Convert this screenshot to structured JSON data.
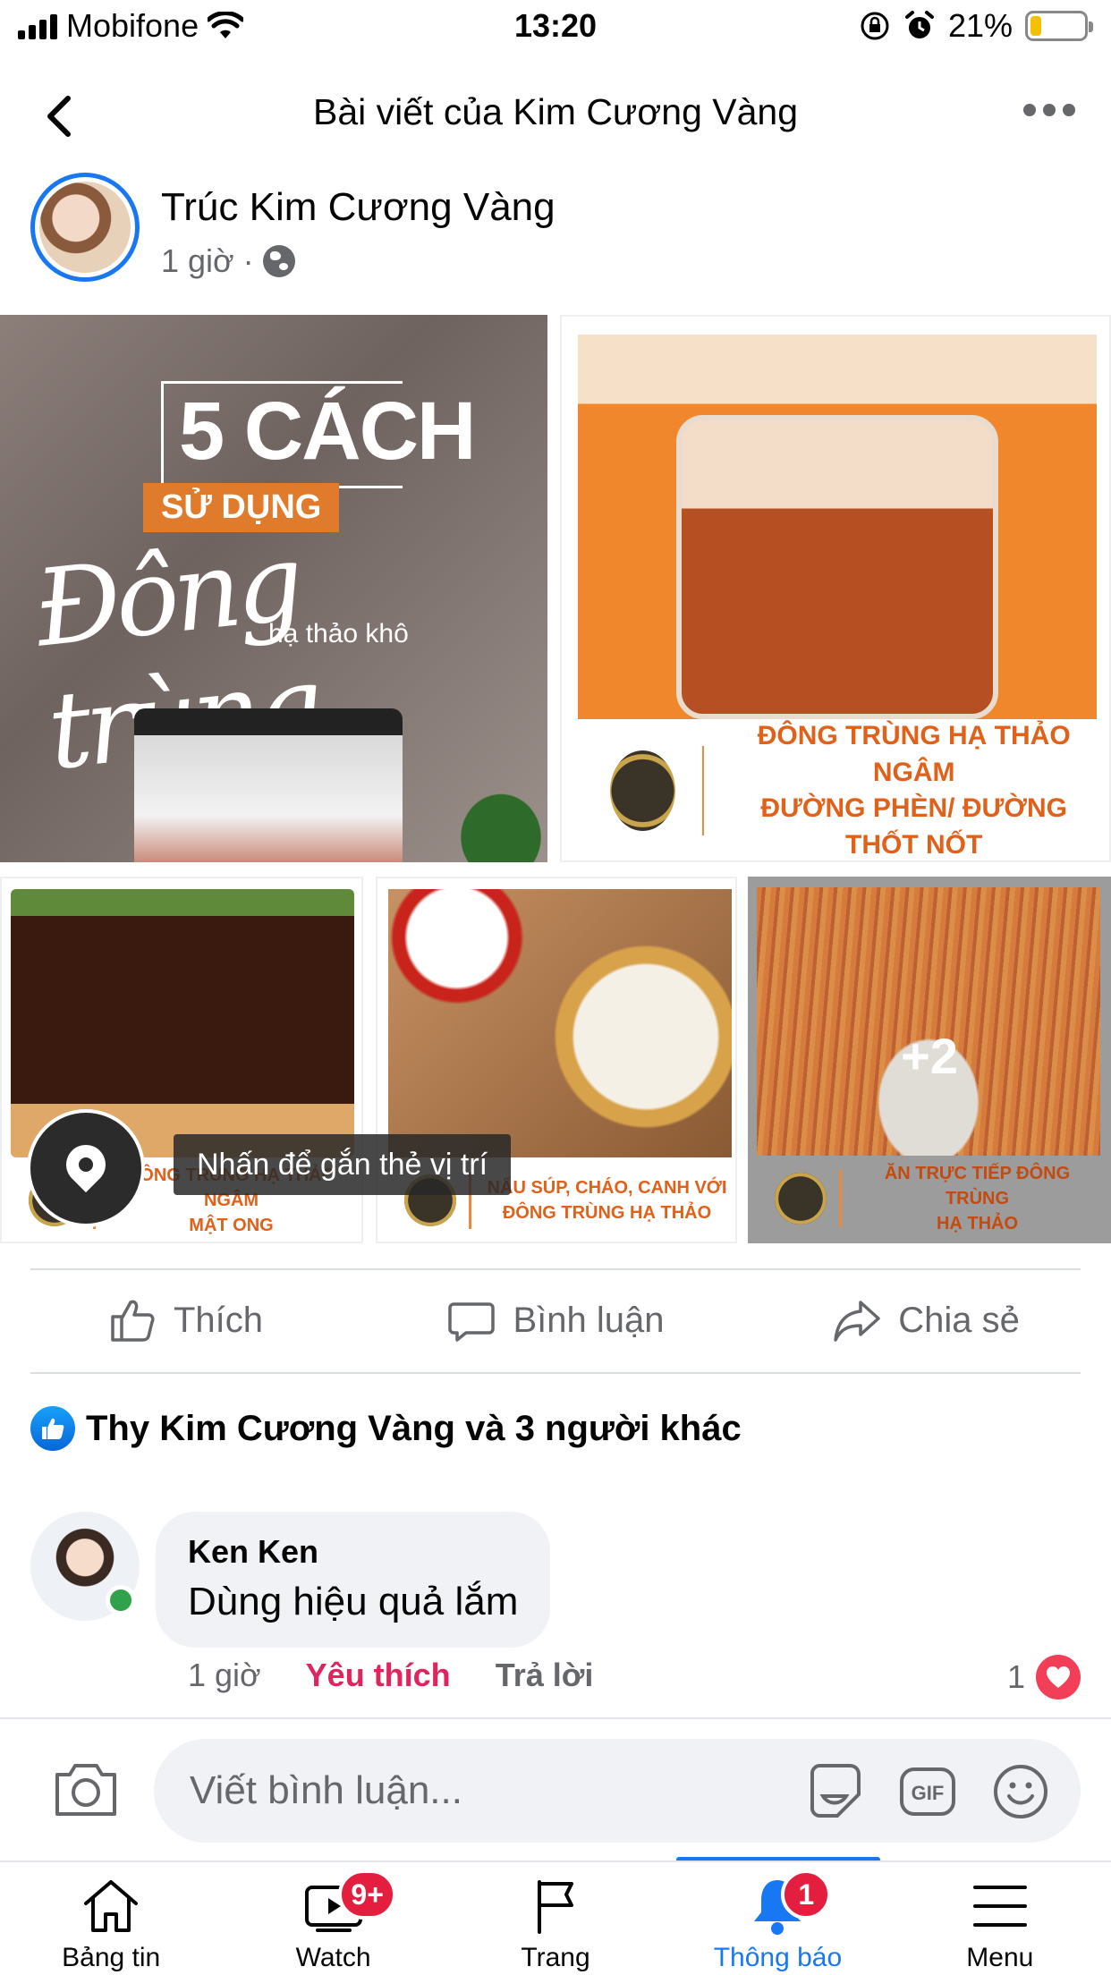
{
  "status_bar": {
    "carrier": "Mobifone",
    "time": "13:20",
    "battery_percent": "21%",
    "battery_level": 0.21
  },
  "header": {
    "title": "Bài viết của Kim Cương Vàng"
  },
  "post": {
    "author": "Trúc Kim Cương Vàng",
    "time": "1 giờ",
    "separator": "·",
    "privacy_icon": "globe-icon",
    "photos": {
      "photo1": {
        "big_text": "5 CÁCH",
        "tag_text": "SỬ DỤNG",
        "script_text": "Đông trùng",
        "sub_text": "hạ thảo khô"
      },
      "photo2": {
        "caption_line1": "ĐÔNG TRÙNG HẠ THẢO NGÂM",
        "caption_line2": "ĐƯỜNG PHÈN/ ĐƯỜNG THỐT NỐT"
      },
      "photo3": {
        "caption_line1": "ĐÔNG TRÙNG HẠ THẢO NGÂM",
        "caption_line2": "MẬT ONG"
      },
      "photo4": {
        "caption_line1": "NẤU SÚP, CHÁO, CANH VỚI",
        "caption_line2": "ĐÔNG TRÙNG HẠ THẢO"
      },
      "photo5": {
        "caption_line1": "ĂN TRỰC TIẾP ĐÔNG TRÙNG",
        "caption_line2": "HẠ THẢO",
        "more_count": "+2"
      }
    },
    "location_tag": "Nhấn để gắn thẻ vị trí",
    "actions": {
      "like": "Thích",
      "comment": "Bình luận",
      "share": "Chia sẻ"
    },
    "reactions_summary": "Thy Kim Cương Vàng và 3 người khác"
  },
  "comment": {
    "author": "Ken Ken",
    "text": "Dùng hiệu quả lắm",
    "time": "1 giờ",
    "reaction_label": "Yêu thích",
    "reply_label": "Trả lời",
    "reaction_count": "1"
  },
  "composer": {
    "placeholder": "Viết bình luận...",
    "gif_label": "GIF"
  },
  "tabbar": {
    "tabs": [
      {
        "label": "Bảng tin",
        "icon": "home-icon"
      },
      {
        "label": "Watch",
        "icon": "watch-icon",
        "badge": "9+"
      },
      {
        "label": "Trang",
        "icon": "flag-icon"
      },
      {
        "label": "Thông báo",
        "icon": "bell-icon",
        "badge": "1",
        "active": true
      },
      {
        "label": "Menu",
        "icon": "menu-icon"
      }
    ]
  },
  "colors": {
    "accent": "#1877f2",
    "love": "#e0245e",
    "badge": "#e41e3f",
    "brand_orange": "#e0611a"
  }
}
